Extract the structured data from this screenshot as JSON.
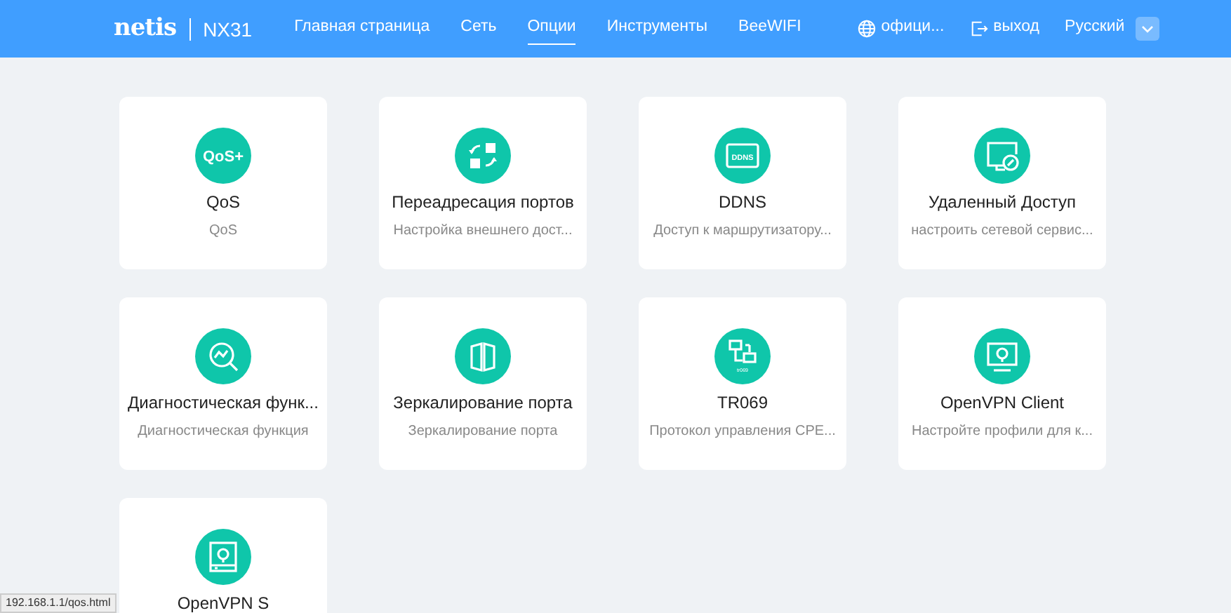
{
  "header": {
    "logo": "netis",
    "model": "NX31",
    "nav": [
      {
        "label": "Главная страница",
        "selected": false
      },
      {
        "label": "Сеть",
        "selected": false
      },
      {
        "label": "Опции",
        "selected": true
      },
      {
        "label": "Инструменты",
        "selected": false
      },
      {
        "label": "BeeWIFI",
        "selected": false
      }
    ],
    "official_link": "офици...",
    "logout": "выход",
    "language": "Русский"
  },
  "cards": [
    {
      "kind": "qos",
      "icon_text": "QoS+",
      "title": "QoS",
      "subtitle": "QoS"
    },
    {
      "kind": "forward",
      "title": "Переадресация портов",
      "subtitle": "Настройка внешнего дост..."
    },
    {
      "kind": "ddns",
      "icon_text": "DDNS",
      "title": "DDNS",
      "subtitle": "Доступ к маршрутизатору..."
    },
    {
      "kind": "remote",
      "title": "Удаленный Доступ",
      "subtitle": "настроить сетевой сервис..."
    },
    {
      "kind": "diag",
      "title": "Диагностическая функ...",
      "subtitle": "Диагностическая функция"
    },
    {
      "kind": "mirror",
      "title": "Зеркалирование порта",
      "subtitle": "Зеркалирование порта"
    },
    {
      "kind": "tr069",
      "icon_text": "tr069",
      "title": "TR069",
      "subtitle": "Протокол управления CPE..."
    },
    {
      "kind": "vpnclient",
      "title": "OpenVPN Client",
      "subtitle": "Настройте профили для к..."
    },
    {
      "kind": "vpnserver",
      "title": "OpenVPN S"
    }
  ],
  "status_url": "192.168.1.1/qos.html"
}
